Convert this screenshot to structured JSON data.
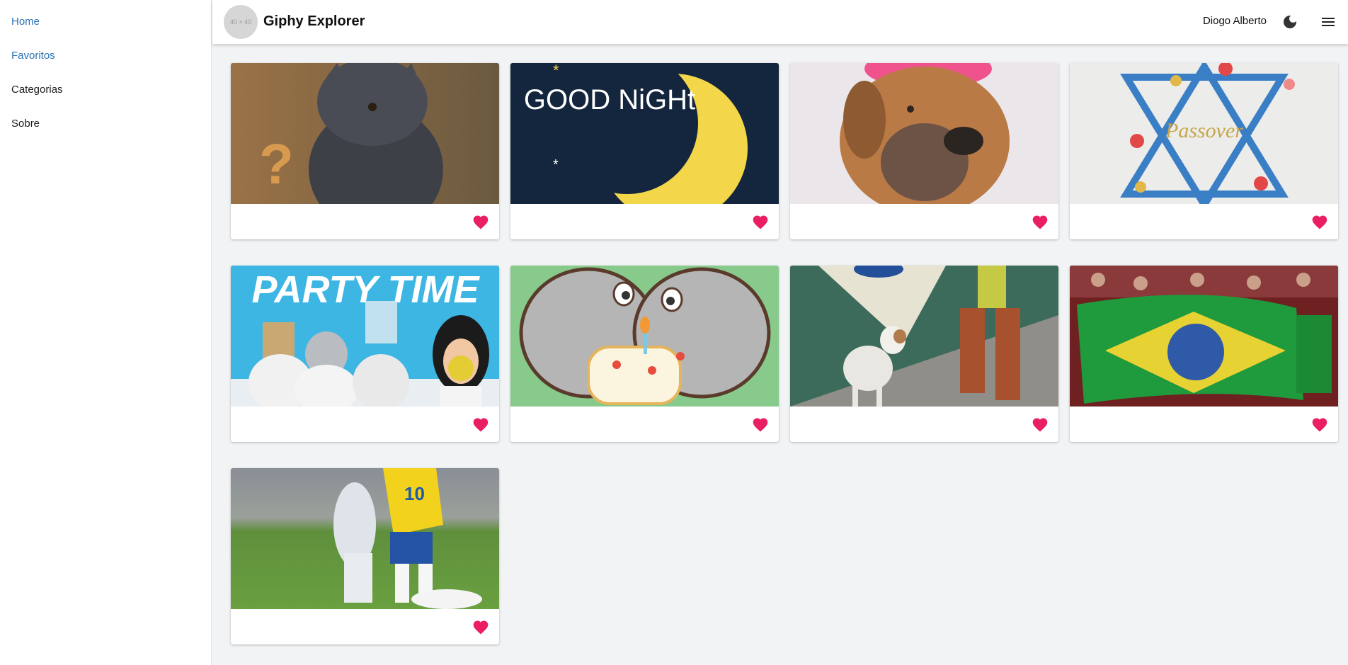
{
  "sidebar": {
    "items": [
      {
        "label": "Home",
        "active": true
      },
      {
        "label": "Favoritos",
        "active": true
      },
      {
        "label": "Categorias",
        "active": false
      },
      {
        "label": "Sobre",
        "active": false
      }
    ]
  },
  "header": {
    "avatar_placeholder": "40 × 40",
    "title": "Giphy Explorer",
    "user_name": "Diogo Alberto",
    "theme_icon": "moon-icon",
    "menu_icon": "menu-icon"
  },
  "colors": {
    "accent_link": "#2a72b5",
    "favorite": "#e91e63",
    "page_bg": "#f2f3f5"
  },
  "gifs": [
    {
      "subject": "gray kitten puppet with question mark",
      "favorited": true
    },
    {
      "subject": "good night moon",
      "text": "GOOD NiGHt",
      "favorited": true
    },
    {
      "subject": "shar pei puppy with pink hat",
      "favorited": true
    },
    {
      "subject": "passover star of david",
      "text": "Passover",
      "favorited": true
    },
    {
      "subject": "party time people with masks",
      "text": "PARTY TIME",
      "favorited": true
    },
    {
      "subject": "birthday cake cartoon",
      "favorited": true
    },
    {
      "subject": "small dog in street",
      "favorited": true
    },
    {
      "subject": "brazil flag crowd",
      "favorited": true
    },
    {
      "subject": "soccer player brazil number 10",
      "text": "10",
      "favorited": true
    }
  ]
}
